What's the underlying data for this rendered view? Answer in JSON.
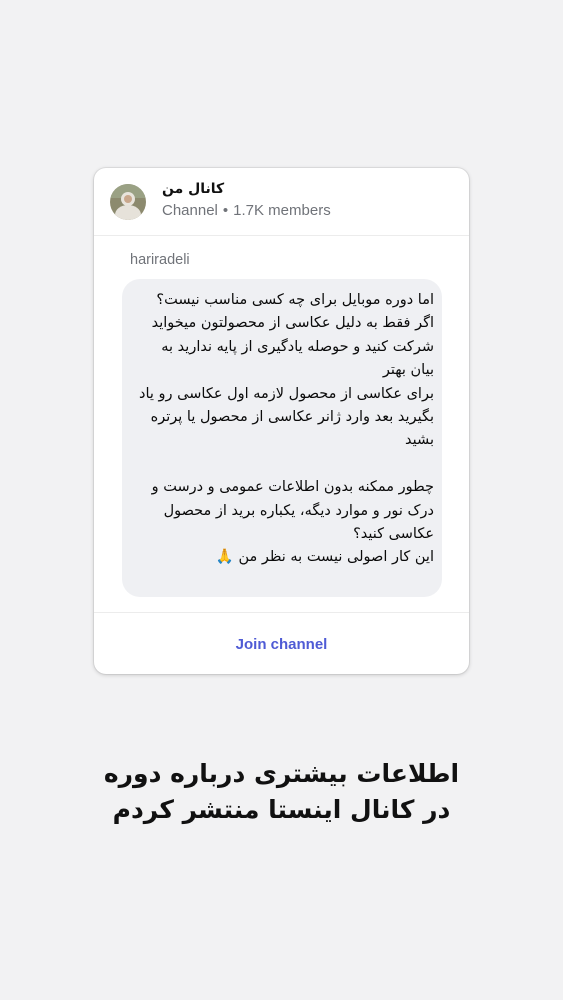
{
  "channel": {
    "name": "کانال من",
    "type_label": "Channel",
    "separator": "•",
    "members": "1.7K members",
    "avatar_icon": "profile-photo-icon"
  },
  "message": {
    "sender": "hariradeli",
    "text": "اما دوره موبایل برای چه کسی مناسب نیست؟\nاگر فقط به دلیل عکاسی از محصولتون میخواید شرکت کنید و حوصله یادگیری از پایه ندارید به بیان بهتر\nبرای عکاسی از محصول لازمه اول عکاسی رو یاد بگیرید بعد وارد ژانر عکاسی از محصول یا پرتره بشید\n\nچطور ممکنه بدون اطلاعات عمومی و درست و درک نور و موارد دیگه، یکباره برید از محصول عکاسی کنید؟\nاین کار اصولی نیست به نظر من 🙏"
  },
  "footer": {
    "join_label": "Join channel"
  },
  "caption": {
    "line1": "اطلاعات بیشتری درباره دوره",
    "line2": "در کانال اینستا منتشر کردم"
  },
  "colors": {
    "background": "#f2f2f3",
    "card": "#ffffff",
    "bubble": "#eff0f3",
    "accent": "#4f5bd5",
    "muted": "#707379"
  }
}
